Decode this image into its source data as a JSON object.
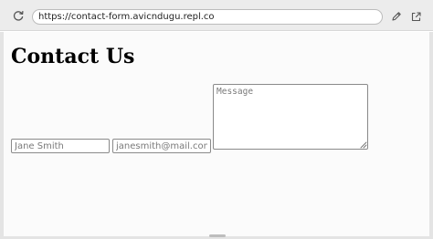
{
  "browser": {
    "url": "https://contact-form.avicndugu.repl.co",
    "icons": {
      "reload": "reload-icon",
      "edit": "pencil-icon",
      "open_new_tab": "open-external-icon"
    }
  },
  "page": {
    "title": "Contact Us",
    "form": {
      "name_placeholder": "Jane Smith",
      "email_placeholder": "janesmith@mail.com",
      "message_placeholder": "Message"
    }
  },
  "colors": {
    "toolbar": "#ececec",
    "page_background": "#fbfbfb",
    "field_border": "#8a8a8a",
    "placeholder": "#7a7a7a"
  }
}
